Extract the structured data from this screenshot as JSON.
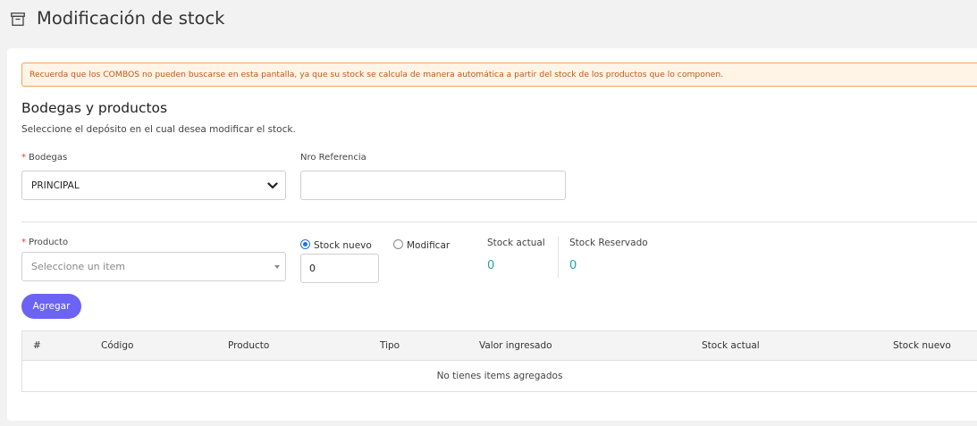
{
  "header": {
    "title": "Modificación de stock",
    "icon": "archive-icon"
  },
  "alert": {
    "text": "Recuerda que los COMBOS no pueden buscarse en esta pantalla, ya que su stock se calcula de manera automática a partir del stock de los productos que lo componen."
  },
  "section": {
    "title": "Bodegas y productos",
    "subtitle": "Seleccione el depósito en el cual desea modificar el stock."
  },
  "bodegas": {
    "required_mark": "*",
    "label": "Bodegas",
    "value": "PRINCIPAL"
  },
  "referencia": {
    "label": "Nro Referencia",
    "value": ""
  },
  "producto": {
    "required_mark": "*",
    "label": "Producto",
    "placeholder": "Seleccione un item"
  },
  "mode": {
    "option_new": "Stock nuevo",
    "option_modify": "Modificar",
    "selected": "Stock nuevo"
  },
  "quantity": {
    "value": "0"
  },
  "stock_actual": {
    "label": "Stock actual",
    "value": "0"
  },
  "stock_reservado": {
    "label": "Stock Reservado",
    "value": "0"
  },
  "buttons": {
    "add_label": "Agregar"
  },
  "table": {
    "headers": [
      "#",
      "Código",
      "Producto",
      "Tipo",
      "Valor ingresado",
      "Stock actual",
      "Stock nuevo"
    ],
    "empty_text": "No tienes items agregados"
  },
  "colors": {
    "accent": "#6c63f5",
    "alert_border": "#f5a35c",
    "alert_text": "#c0591a",
    "stat_value": "#2aa198",
    "radio_active": "#1e73e8"
  }
}
